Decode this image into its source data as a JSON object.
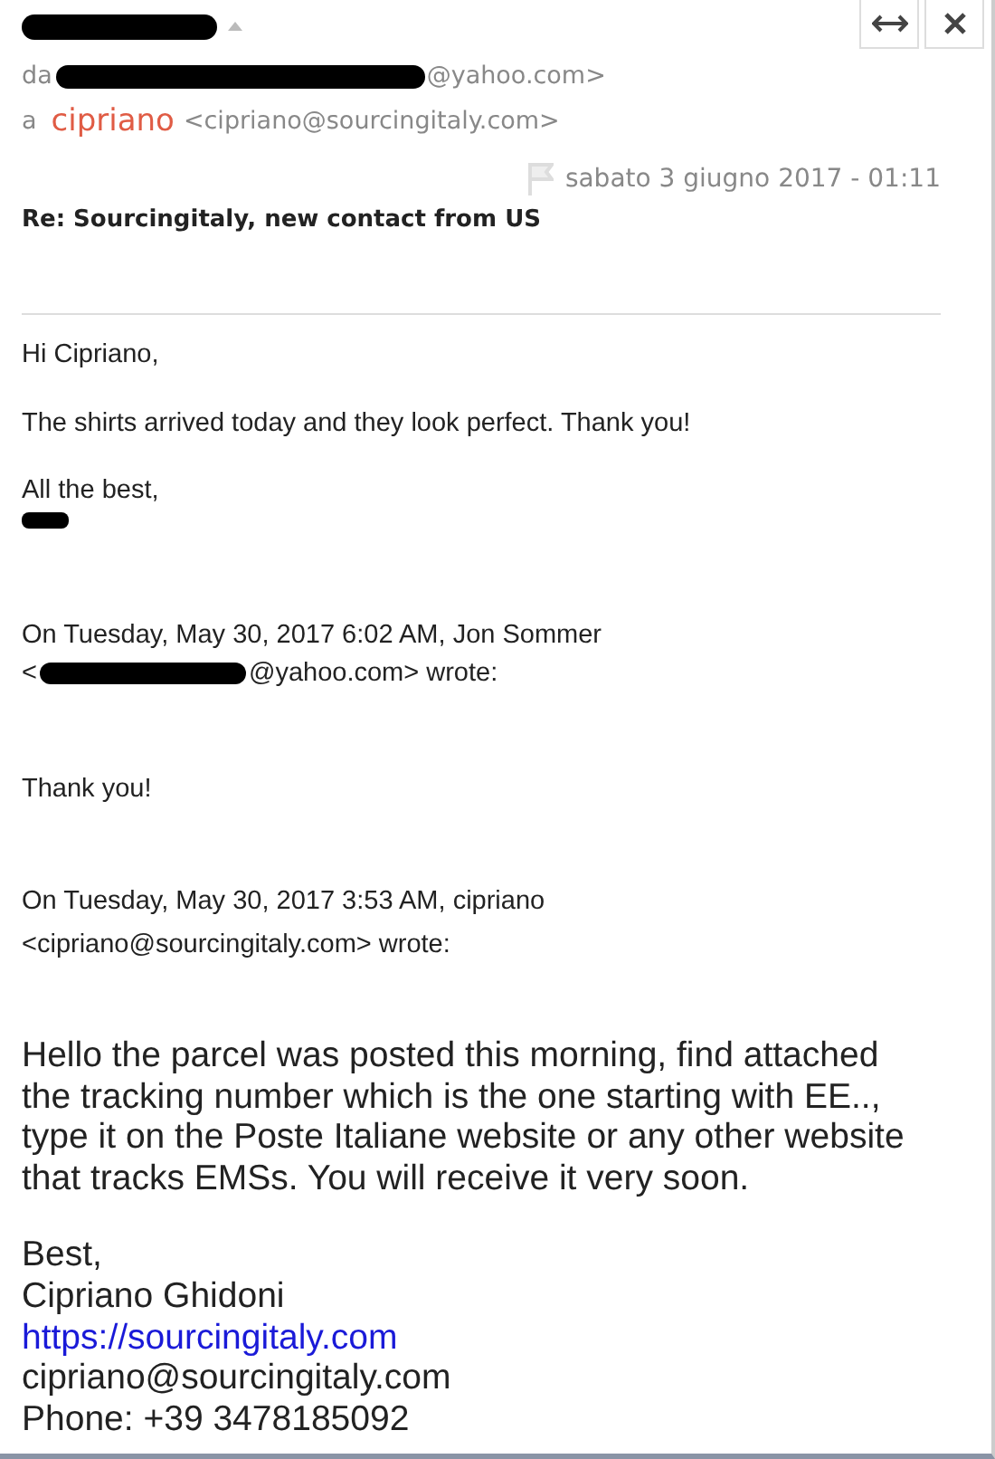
{
  "header": {
    "from_prefix": "da",
    "from_suffix": "@yahoo.com>",
    "to_prefix": "a",
    "to_name": "cipriano",
    "to_address": "<cipriano@sourcingitaly.com>",
    "date": "sabato 3 giugno 2017 - 01:11",
    "subject": "Re: Sourcingitaly, new contact from US"
  },
  "body": {
    "greeting": "Hi Cipriano,",
    "message": "The shirts arrived today and they look perfect. Thank you!",
    "closing": "All the best,",
    "quote1_header": "On Tuesday, May 30, 2017 6:02 AM, Jon Sommer",
    "quote1_address_prefix": "<",
    "quote1_address_suffix": "@yahoo.com> wrote:",
    "quote1_text": "Thank you!",
    "quote2_header": "On Tuesday, May 30, 2017 3:53 AM, cipriano",
    "quote2_address": "<cipriano@sourcingitaly.com> wrote:",
    "quote2_text": "Hello the parcel was posted this morning, find attached the tracking number which is the one starting with EE.., type it on the Poste Italiane website or any other website that tracks EMSs. You will receive it very soon.",
    "signature": [
      {
        "kind": "text",
        "text": "Best,"
      },
      {
        "kind": "text",
        "text": "Cipriano Ghidoni"
      },
      {
        "kind": "link",
        "text": "https://sourcingitaly.com"
      },
      {
        "kind": "text",
        "text": "cipriano@sourcingitaly.com"
      },
      {
        "kind": "text",
        "text": "Phone: +39 3478185092"
      }
    ]
  }
}
